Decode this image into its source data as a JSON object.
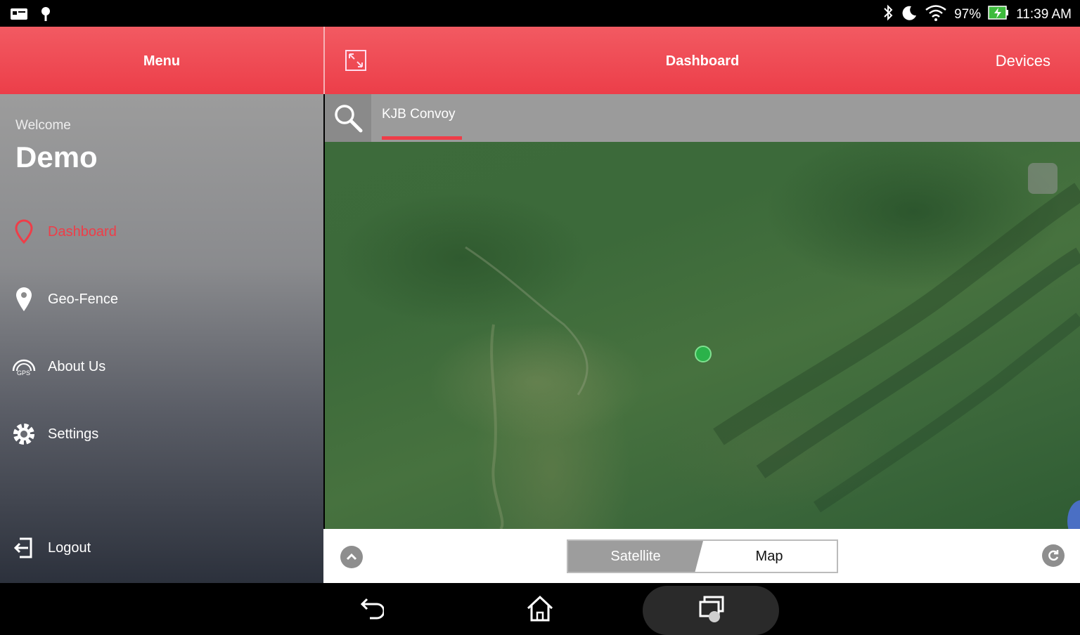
{
  "status_bar": {
    "battery_percent": "97%",
    "time": "11:39 AM",
    "icons_left": [
      "notification-photo-icon",
      "notification-location-icon"
    ],
    "icons_right": [
      "bluetooth-icon",
      "do-not-disturb-moon-icon",
      "wifi-icon",
      "battery-charging-icon"
    ]
  },
  "menu": {
    "title": "Menu",
    "welcome_label": "Welcome",
    "username": "Demo",
    "items": [
      {
        "label": "Dashboard",
        "icon": "map-pin-outline-icon",
        "active": true
      },
      {
        "label": "Geo-Fence",
        "icon": "map-pin-icon",
        "active": false
      },
      {
        "label": "About Us",
        "icon": "gps-logo-icon",
        "active": false
      },
      {
        "label": "Settings",
        "icon": "gear-icon",
        "active": false
      }
    ],
    "logout_label": "Logout"
  },
  "header": {
    "title": "Dashboard",
    "devices_label": "Devices"
  },
  "search": {
    "tab_label": "KJB Convoy"
  },
  "map": {
    "view_toggle": {
      "satellite_label": "Satellite",
      "map_label": "Map",
      "selected": "Satellite"
    }
  },
  "colors": {
    "accent": "#ef3d48",
    "header_red": "#f04a53",
    "marker_green": "#2bb24a"
  }
}
